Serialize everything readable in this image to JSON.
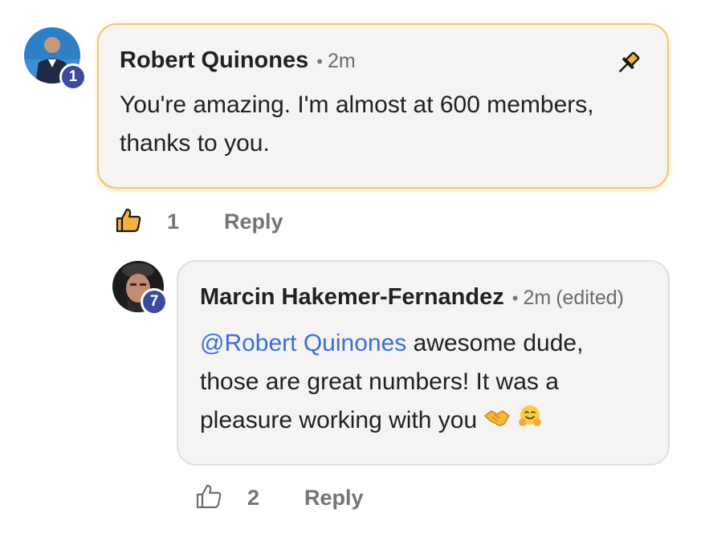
{
  "comments": [
    {
      "author": "Robert Quinones",
      "time": "2m",
      "level": "1",
      "text": "You're amazing. I'm almost at 600 members, thanks to you.",
      "pinned": true,
      "likes": "1",
      "reply_label": "Reply",
      "icons": {
        "pin": "pin-icon",
        "like": "thumbs-up-filled-icon"
      }
    }
  ],
  "replies": [
    {
      "author": "Marcin Hakemer-Fernandez",
      "time": "2m",
      "edited": "(edited)",
      "level": "7",
      "mention": "@Robert Quinones",
      "text_line1": " awesome dude,",
      "text_line2": "those are great numbers! It was a",
      "text_line3": "pleasure working with you",
      "emojis": [
        "handshake-emoji",
        "hugging-face-emoji"
      ],
      "likes": "2",
      "reply_label": "Reply",
      "icons": {
        "like": "thumbs-up-outline-icon"
      }
    }
  ],
  "colors": {
    "pinned_border": "#f5c66e",
    "bubble_bg": "#f5f4f2",
    "mention": "#3b6fd8",
    "level_badge": "#3c4a9e",
    "like_active": "#f2b33d"
  }
}
